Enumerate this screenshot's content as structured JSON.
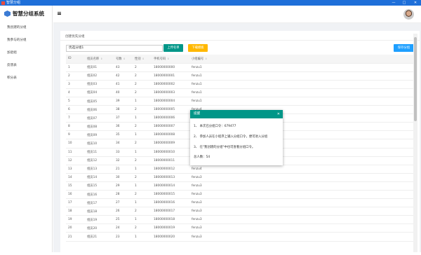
{
  "window": {
    "title": "智慧分组",
    "min": "—",
    "max": "□",
    "close": "✕"
  },
  "sidebar": {
    "logo_text": "智慧分组系统",
    "items": [
      {
        "label": "我创建的分组"
      },
      {
        "label": "我参与的分组"
      },
      {
        "label": "加退组"
      },
      {
        "label": "反馈表"
      },
      {
        "label": "积分表"
      }
    ]
  },
  "header": {
    "menu_icon": "hamburger-icon",
    "avatar_icon": "user-avatar"
  },
  "panel": {
    "title": "创建优先分组",
    "input_value": "优选分组1",
    "upload_btn": "上传名单",
    "download_btn": "下载模板",
    "save_btn": "保存分组",
    "colors": {
      "upload": "#009688",
      "download": "#FFB800",
      "save": "#1E9FFF"
    }
  },
  "table": {
    "headers": [
      "ID",
      "组员名称",
      "号数",
      "性别",
      "手机号码",
      "小组编号"
    ],
    "rows": [
      [
        "1",
        "组员01",
        "43",
        "2",
        "18000000000",
        "fenzu1"
      ],
      [
        "2",
        "组员02",
        "42",
        "2",
        "18000000001",
        "fenzu1"
      ],
      [
        "3",
        "组员03",
        "41",
        "2",
        "18000000002",
        "fenzu1"
      ],
      [
        "4",
        "组员04",
        "40",
        "2",
        "18000000003",
        "fenzu1"
      ],
      [
        "5",
        "组员05",
        "39",
        "1",
        "18000000004",
        "fenzu1"
      ],
      [
        "6",
        "组员06",
        "38",
        "2",
        "18000000005",
        "fenzu4"
      ],
      [
        "7",
        "组员07",
        "37",
        "1",
        "18000000006",
        "fenzu4"
      ],
      [
        "8",
        "组员08",
        "36",
        "2",
        "18000000007",
        "fenzu4"
      ],
      [
        "9",
        "组员09",
        "35",
        "1",
        "18000000008",
        "fenzu4"
      ],
      [
        "10",
        "组员10",
        "34",
        "2",
        "18000000009",
        "fenzu4"
      ],
      [
        "11",
        "组员11",
        "33",
        "1",
        "18000000010",
        "fenzu4"
      ],
      [
        "12",
        "组员12",
        "32",
        "2",
        "18000000011",
        "fenzu4"
      ],
      [
        "13",
        "组员13",
        "21",
        "1",
        "18000000012",
        "fenzu4"
      ],
      [
        "14",
        "组员14",
        "30",
        "2",
        "18000000013",
        "fenzu3"
      ],
      [
        "15",
        "组员15",
        "29",
        "1",
        "18000000014",
        "fenzu3"
      ],
      [
        "16",
        "组员16",
        "28",
        "2",
        "18000000015",
        "fenzu3"
      ],
      [
        "17",
        "组员17",
        "27",
        "1",
        "18000000016",
        "fenzu3"
      ],
      [
        "18",
        "组员18",
        "26",
        "2",
        "18000000017",
        "fenzu3"
      ],
      [
        "19",
        "组员19",
        "25",
        "1",
        "18000000018",
        "fenzu3"
      ],
      [
        "20",
        "组员20",
        "24",
        "2",
        "18000000019",
        "fenzu3"
      ],
      [
        "21",
        "组员21",
        "23",
        "1",
        "18000000020",
        "fenzu3"
      ]
    ]
  },
  "modal": {
    "title": "提醒",
    "close": "✕",
    "line1": "1、 本次已分组口令：679477",
    "line2": "2、 参加人员在小程序上输入分组口令，便可进入分组",
    "line3": "3、 在\"我创建的分组\"中也可查看分组口令。",
    "line4": "总人数：54"
  }
}
